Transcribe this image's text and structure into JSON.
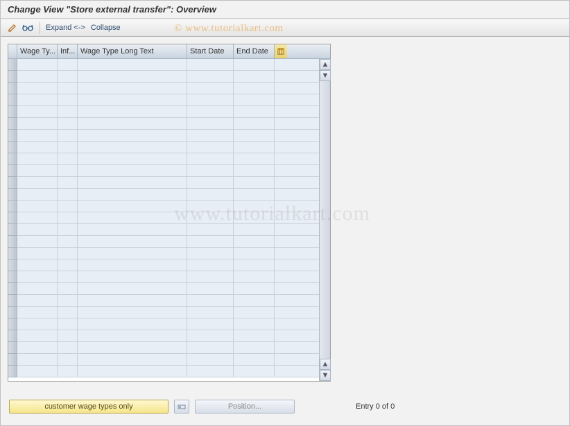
{
  "title": "Change View \"Store external transfer\": Overview",
  "toolbar": {
    "expand_label": "Expand <->",
    "collapse_label": "Collapse"
  },
  "grid": {
    "columns": [
      "Wage Ty...",
      "Inf...",
      "Wage Type Long Text",
      "Start Date",
      "End Date"
    ],
    "row_count": 27
  },
  "bottom": {
    "customer_btn": "customer wage types only",
    "position_btn": "Position...",
    "entry_status": "Entry 0 of 0"
  },
  "watermarks": {
    "wm1": "©   www.tutorialkart.com",
    "wm2": "www.tutorialkart.com"
  }
}
